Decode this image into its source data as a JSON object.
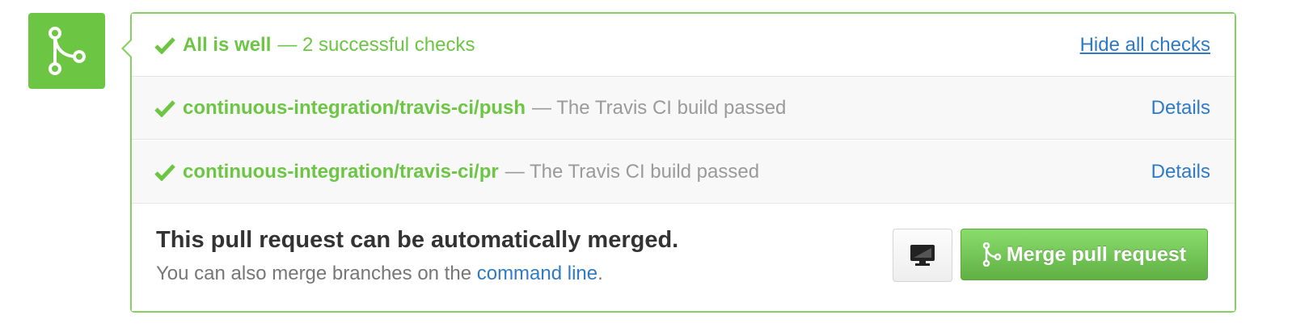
{
  "colors": {
    "success": "#6cc644",
    "link": "#2f7ac7",
    "muted": "#9a9a9a"
  },
  "status_icon": "git-merge-icon",
  "summary": {
    "strong": "All is well",
    "rest": "— 2 successful checks",
    "toggle_label": "Hide all checks",
    "icon": "checkmark-icon"
  },
  "checks": [
    {
      "name": "continuous-integration/travis-ci/push",
      "description": "— The Travis CI build passed",
      "link_label": "Details",
      "state": "success"
    },
    {
      "name": "continuous-integration/travis-ci/pr",
      "description": "— The Travis CI build passed",
      "link_label": "Details",
      "state": "success"
    }
  ],
  "merge": {
    "title": "This pull request can be automatically merged.",
    "subtitle_prefix": "You can also merge branches on the ",
    "subtitle_link": "command line",
    "subtitle_suffix": ".",
    "desktop_icon": "desktop-icon",
    "button_label": "Merge pull request",
    "button_icon": "git-merge-icon"
  }
}
